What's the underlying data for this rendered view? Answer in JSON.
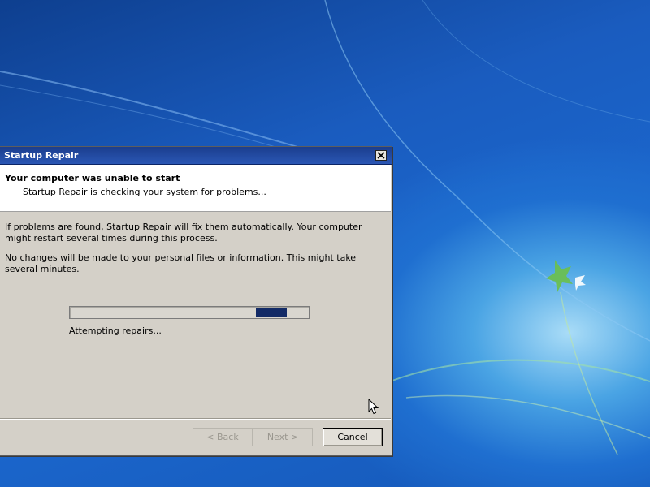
{
  "colors": {
    "desktop_blue": "#1b66cc",
    "title_bar": "#1b3e8e",
    "dialog_face": "#d4d0c8",
    "progress_chunk": "#122a66"
  },
  "window": {
    "title": "Startup Repair",
    "close_icon": "close-icon"
  },
  "header": {
    "title": "Your computer was unable to start",
    "subtitle": "Startup Repair is checking your system for problems..."
  },
  "body": {
    "paragraph1": "If problems are found, Startup Repair will fix them automatically. Your computer might restart several times during this process.",
    "paragraph2": "No changes will be made to your personal files or information. This might take several minutes."
  },
  "progress": {
    "style": "marquee",
    "chunk_position": 0.9,
    "status": "Attempting repairs..."
  },
  "buttons": {
    "back": "< Back",
    "next": "Next >",
    "cancel": "Cancel"
  }
}
